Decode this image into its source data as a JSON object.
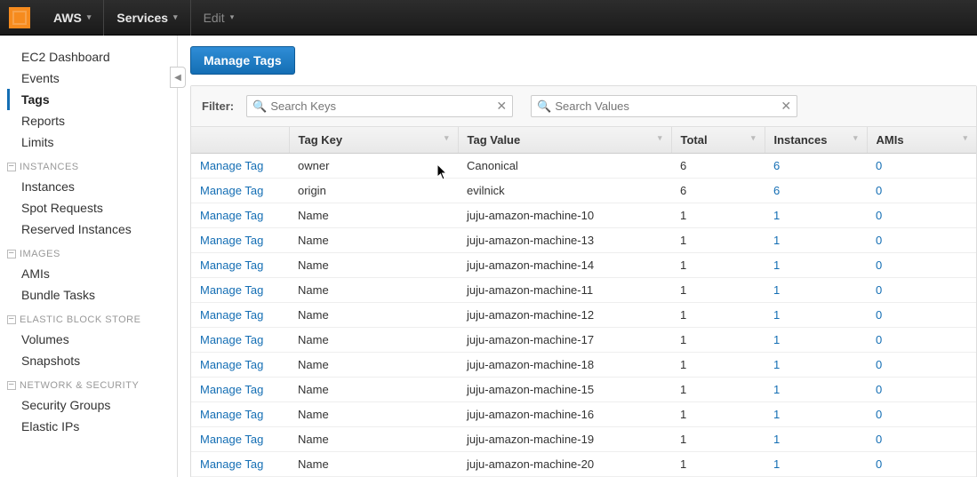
{
  "topnav": {
    "brand": "AWS",
    "services": "Services",
    "edit": "Edit"
  },
  "sidebar": {
    "top": [
      {
        "label": "EC2 Dashboard",
        "active": false
      },
      {
        "label": "Events",
        "active": false
      },
      {
        "label": "Tags",
        "active": true
      },
      {
        "label": "Reports",
        "active": false
      },
      {
        "label": "Limits",
        "active": false
      }
    ],
    "groups": [
      {
        "title": "INSTANCES",
        "items": [
          "Instances",
          "Spot Requests",
          "Reserved Instances"
        ]
      },
      {
        "title": "IMAGES",
        "items": [
          "AMIs",
          "Bundle Tasks"
        ]
      },
      {
        "title": "ELASTIC BLOCK STORE",
        "items": [
          "Volumes",
          "Snapshots"
        ]
      },
      {
        "title": "NETWORK & SECURITY",
        "items": [
          "Security Groups",
          "Elastic IPs"
        ]
      }
    ]
  },
  "toolbar": {
    "manage_tags": "Manage Tags"
  },
  "filter": {
    "label": "Filter:",
    "keys_placeholder": "Search Keys",
    "values_placeholder": "Search Values"
  },
  "columns": {
    "manage": "",
    "tag_key": "Tag Key",
    "tag_value": "Tag Value",
    "total": "Total",
    "instances": "Instances",
    "amis": "AMIs"
  },
  "manage_label": "Manage Tag",
  "rows": [
    {
      "key": "owner",
      "value": "Canonical",
      "total": "6",
      "instances": "6",
      "amis": "0"
    },
    {
      "key": "origin",
      "value": "evilnick",
      "total": "6",
      "instances": "6",
      "amis": "0"
    },
    {
      "key": "Name",
      "value": "juju-amazon-machine-10",
      "total": "1",
      "instances": "1",
      "amis": "0"
    },
    {
      "key": "Name",
      "value": "juju-amazon-machine-13",
      "total": "1",
      "instances": "1",
      "amis": "0"
    },
    {
      "key": "Name",
      "value": "juju-amazon-machine-14",
      "total": "1",
      "instances": "1",
      "amis": "0"
    },
    {
      "key": "Name",
      "value": "juju-amazon-machine-11",
      "total": "1",
      "instances": "1",
      "amis": "0"
    },
    {
      "key": "Name",
      "value": "juju-amazon-machine-12",
      "total": "1",
      "instances": "1",
      "amis": "0"
    },
    {
      "key": "Name",
      "value": "juju-amazon-machine-17",
      "total": "1",
      "instances": "1",
      "amis": "0"
    },
    {
      "key": "Name",
      "value": "juju-amazon-machine-18",
      "total": "1",
      "instances": "1",
      "amis": "0"
    },
    {
      "key": "Name",
      "value": "juju-amazon-machine-15",
      "total": "1",
      "instances": "1",
      "amis": "0"
    },
    {
      "key": "Name",
      "value": "juju-amazon-machine-16",
      "total": "1",
      "instances": "1",
      "amis": "0"
    },
    {
      "key": "Name",
      "value": "juju-amazon-machine-19",
      "total": "1",
      "instances": "1",
      "amis": "0"
    },
    {
      "key": "Name",
      "value": "juju-amazon-machine-20",
      "total": "1",
      "instances": "1",
      "amis": "0"
    }
  ]
}
